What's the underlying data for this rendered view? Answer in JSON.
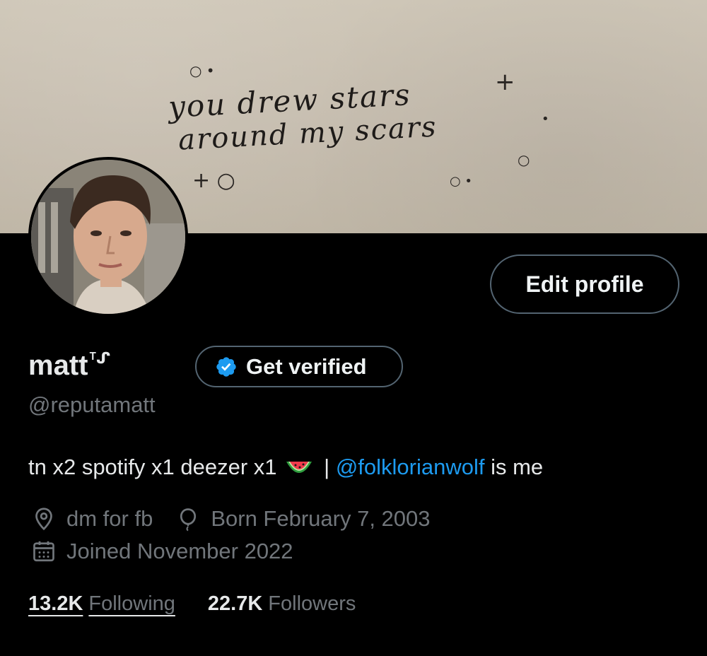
{
  "banner": {
    "line1": "you drew stars",
    "line2": "around my scars",
    "colors": {
      "paper": "#c6bdaf",
      "ink": "#1e1b19"
    }
  },
  "profile": {
    "display_name": "matt",
    "name_suffix": "ᵀᔑ",
    "handle": "@reputamatt",
    "edit_button_label": "Edit profile",
    "verify_button_label": "Get verified"
  },
  "bio": {
    "prefix": "tn x2 spotify x1 deezer x1",
    "separator": " | ",
    "mention": "@folklorianwolf",
    "suffix": " is me",
    "emoji": "watermelon-icon"
  },
  "meta": {
    "location": "dm for fb",
    "birthday": "Born February 7, 2003",
    "joined": "Joined November 2022"
  },
  "stats": {
    "following_count": "13.2K",
    "following_label": "Following",
    "followers_count": "22.7K",
    "followers_label": "Followers"
  },
  "colors": {
    "background": "#000000",
    "text": "#e7e9ea",
    "secondary": "#71767b",
    "accent": "#1d9bf0",
    "border": "#536471"
  }
}
